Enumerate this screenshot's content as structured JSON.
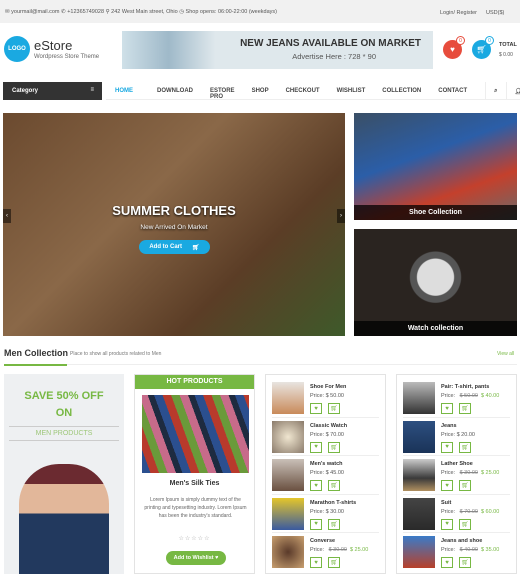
{
  "topbar": {
    "email": "yourmail@mail.com",
    "phone": "+12365749028",
    "address": "242 West Main street, Ohio",
    "hours": "Shop opens: 06:00-22:00 (weekdays)",
    "login": "Login/ Register",
    "currency": "USD($)"
  },
  "header": {
    "logo": "LOGO",
    "brand": "eStore",
    "tagline": "Wordpress Store Theme",
    "banner_title": "NEW JEANS AVAILABLE ON MARKET",
    "banner_sub": "Advertise Here : 728 * 90",
    "wishlist_count": "0",
    "cart_count": "0",
    "total_label": "TOTAL",
    "total_value": "$ 0.00"
  },
  "nav": {
    "category": "Category",
    "items": [
      "HOME",
      "DOWNLOAD",
      "ESTORE PRO",
      "SHOP",
      "CHECKOUT",
      "WISHLIST",
      "COLLECTION",
      "CONTACT"
    ],
    "active": "HOME"
  },
  "slider": {
    "title": "SUMMER CLOTHES",
    "subtitle": "New Arrived On Market",
    "button": "Add to Cart"
  },
  "side": [
    {
      "caption": "Shoe Collection"
    },
    {
      "caption": "Watch collection"
    }
  ],
  "section": {
    "title": "Men Collection",
    "subtitle": "Place to show all products related to Men",
    "view_all": "View all"
  },
  "promo": {
    "line1": "SAVE 50% OFF",
    "line2": "ON",
    "line3": "MEN PRODUCTS"
  },
  "hot": {
    "header": "HOT PRODUCTS",
    "name": "Men's Silk Ties",
    "desc": "Lorem Ipsum is simply dummy text of the printing and typesetting industry. Lorem Ipsum has been the industry's standard.",
    "stars": "☆☆☆☆☆",
    "button": "Add to Wishlist ♥"
  },
  "price_label": "Price:",
  "list1": [
    {
      "name": "Shoe For Men",
      "price": "$ 50.00",
      "old": "",
      "new": ""
    },
    {
      "name": "Classic Watch",
      "price": "$ 70.00",
      "old": "",
      "new": ""
    },
    {
      "name": "Men's watch",
      "price": "$ 45.00",
      "old": "",
      "new": ""
    },
    {
      "name": "Marathon T-shirts",
      "price": "$ 30.00",
      "old": "",
      "new": ""
    },
    {
      "name": "Converse",
      "price": "",
      "old": "$ 30.00",
      "new": "$ 25.00"
    }
  ],
  "list2": [
    {
      "name": "Pair: T-shirt, pants",
      "price": "",
      "old": "$ 50.00",
      "new": "$ 40.00"
    },
    {
      "name": "Jeans",
      "price": "$ 20.00",
      "old": "",
      "new": ""
    },
    {
      "name": "Lather Shoe",
      "price": "",
      "old": "$ 30.00",
      "new": "$ 25.00"
    },
    {
      "name": "Suit",
      "price": "",
      "old": "$ 70.00",
      "new": "$ 60.00"
    },
    {
      "name": "Jeans and shoe",
      "price": "",
      "old": "$ 40.00",
      "new": "$ 35.00"
    }
  ],
  "colors": {
    "accent": "#1aa9e1",
    "green": "#77b843",
    "wishlist": "#e74c3c",
    "dark": "#333333"
  }
}
